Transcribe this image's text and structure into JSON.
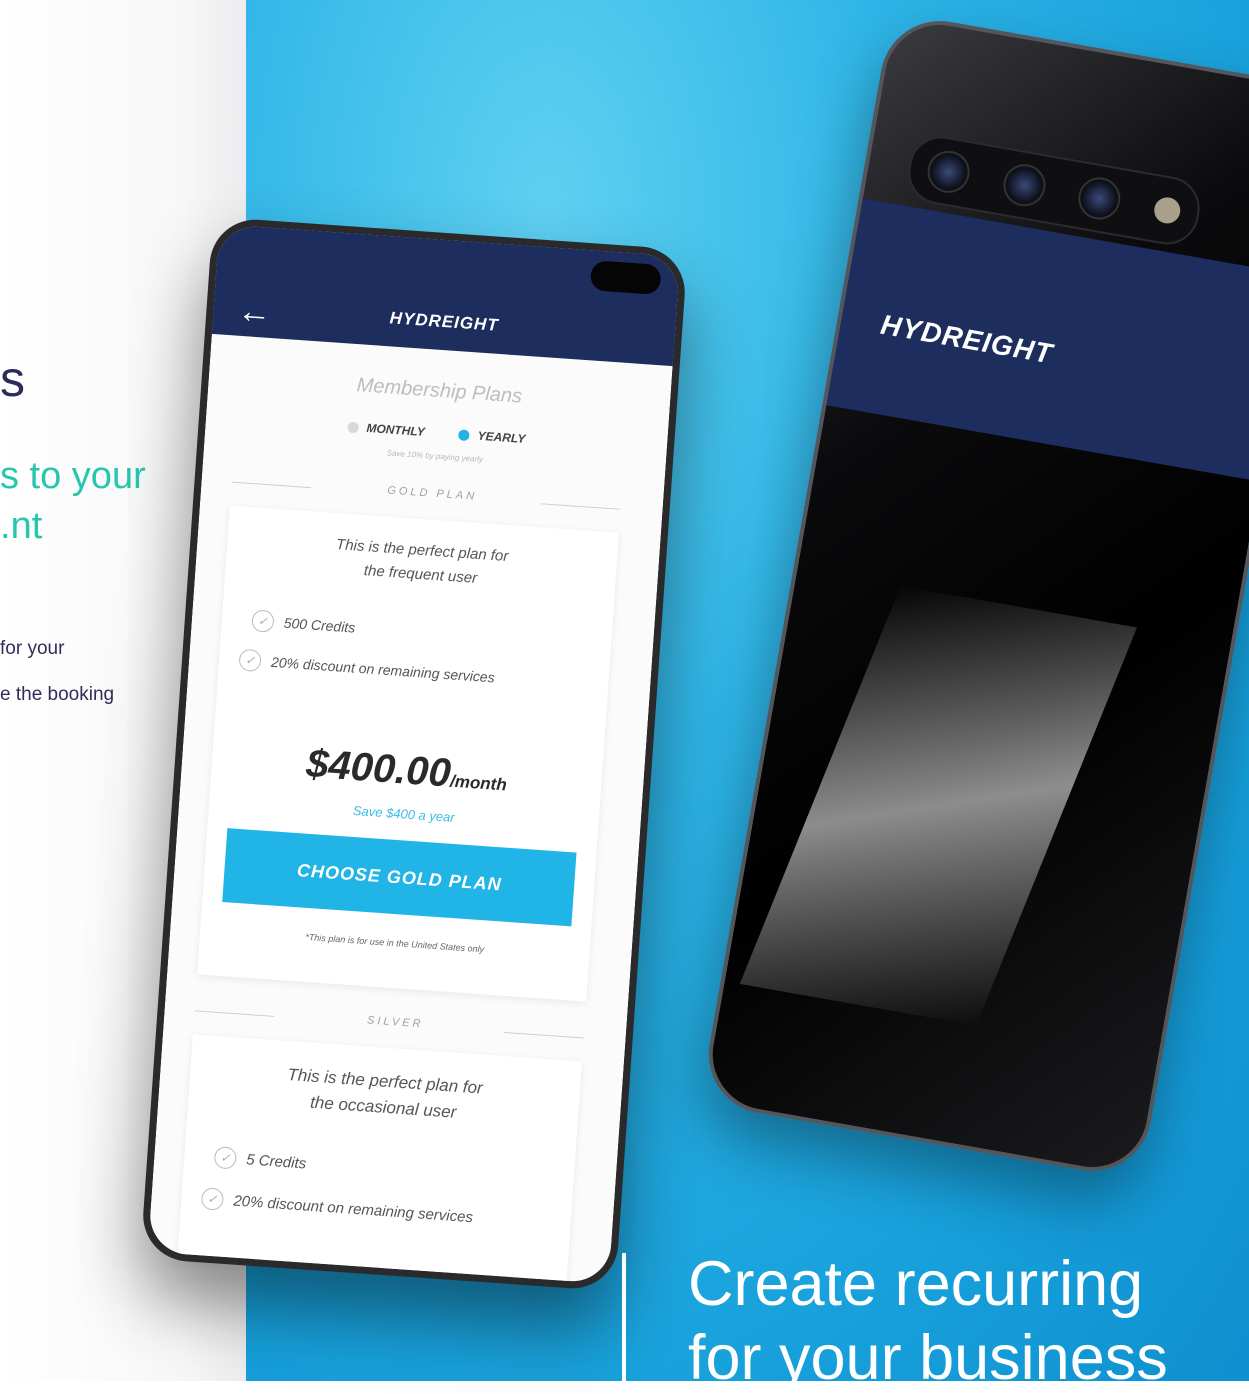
{
  "left_panel": {
    "heading_fragment": "s",
    "subheading_lines": [
      "s to your",
      "nt."
    ],
    "body_lines": [
      "for your",
      "e the booking"
    ]
  },
  "brand": {
    "logo": "HYDREIGHT"
  },
  "app": {
    "back_icon": "arrow-left-icon",
    "screen_title": "Membership Plans",
    "billing_toggle": {
      "options": [
        "MONTHLY",
        "YEARLY"
      ],
      "selected": "YEARLY",
      "note": "Save 10% by paying yearly"
    },
    "plans": [
      {
        "section_label": "GOLD PLAN",
        "description_lines": [
          "This is the perfect plan for",
          "the frequent user"
        ],
        "features": [
          "500 Credits",
          "20% discount on remaining services"
        ],
        "price": "$400.00",
        "price_unit": "/month",
        "savings": "Save $400 a year",
        "cta": "CHOOSE GOLD PLAN",
        "fine_print": "*This plan is for use in the United States only"
      },
      {
        "section_label": "SILVER",
        "description_lines": [
          "This is the perfect plan for",
          "the occasional user"
        ],
        "features": [
          "5 Credits",
          "20% discount on remaining services"
        ]
      }
    ]
  },
  "tagline": {
    "lines": [
      "Create recurring",
      "for your business"
    ]
  },
  "colors": {
    "navy": "#1d2d5d",
    "sky_blue": "#21b4e7",
    "teal": "#26c7ae",
    "heading_purple": "#2b2c5a"
  }
}
